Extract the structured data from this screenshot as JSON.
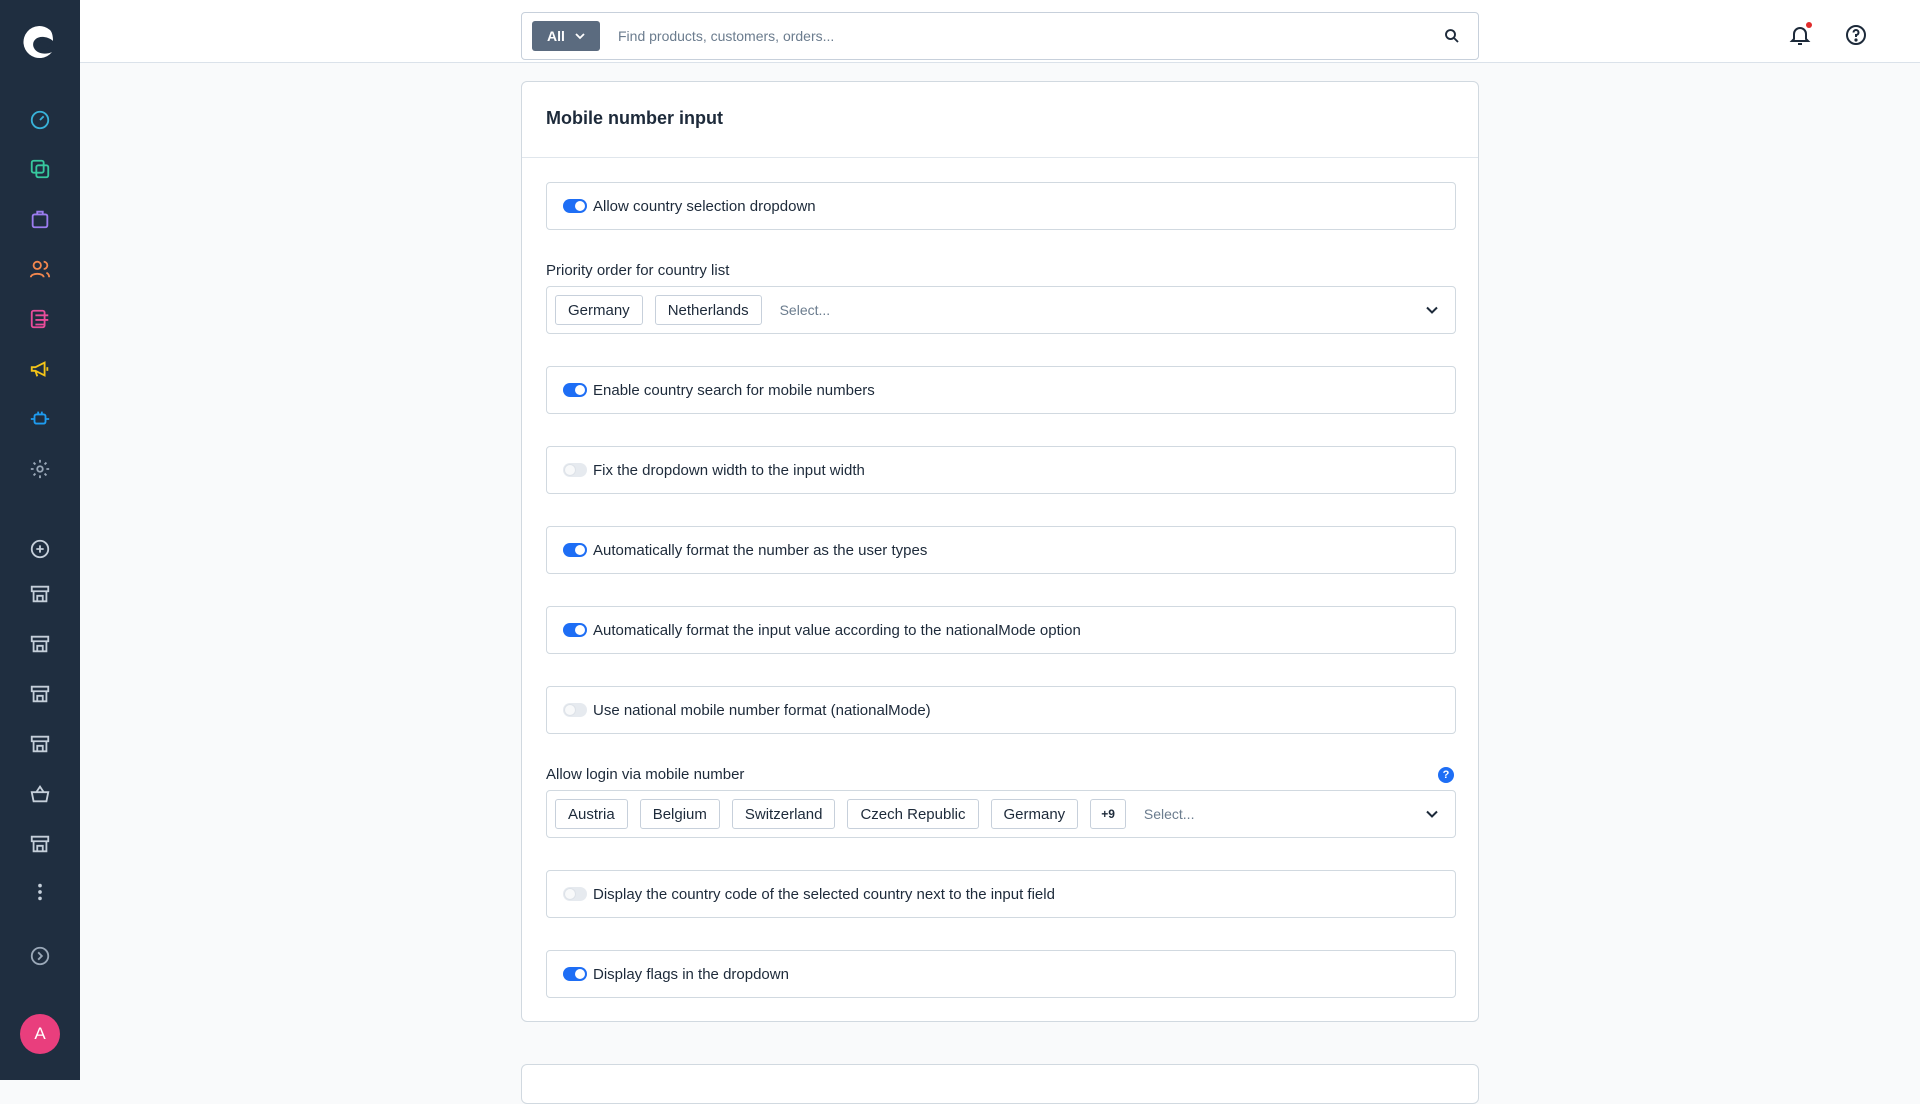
{
  "search": {
    "scope_label": "All",
    "placeholder": "Find products, customers, orders..."
  },
  "sidebar": {
    "avatar_initial": "A",
    "icons": [
      "dashboard-icon",
      "catalogue-icon",
      "orders-icon",
      "customers-icon",
      "content-icon",
      "marketing-icon",
      "extensions-icon",
      "settings-icon",
      "add-sales-channel-icon",
      "sales-channel-icon",
      "sales-channel-icon",
      "sales-channel-icon",
      "sales-channel-icon",
      "basket-icon",
      "sales-channel-icon",
      "more-icon",
      "expand-icon"
    ]
  },
  "card": {
    "title": "Mobile number input"
  },
  "settings": {
    "allow_country_dropdown": {
      "label": "Allow country selection dropdown",
      "enabled": true
    },
    "priority_order": {
      "label": "Priority order for country list",
      "selected": [
        "Germany",
        "Netherlands"
      ],
      "placeholder": "Select..."
    },
    "enable_country_search": {
      "label": "Enable country search for mobile numbers",
      "enabled": true
    },
    "fix_dropdown_width": {
      "label": "Fix the dropdown width to the input width",
      "enabled": false
    },
    "auto_format": {
      "label": "Automatically format the number as the user types",
      "enabled": true
    },
    "auto_format_national": {
      "label": "Automatically format the input value according to the nationalMode option",
      "enabled": true
    },
    "national_mode": {
      "label": "Use national mobile number format (nationalMode)",
      "enabled": false
    },
    "login_via_mobile": {
      "label": "Allow login via mobile number",
      "help": "?",
      "selected": [
        "Austria",
        "Belgium",
        "Switzerland",
        "Czech Republic",
        "Germany"
      ],
      "more": "+9",
      "placeholder": "Select..."
    },
    "display_country_code": {
      "label": "Display the country code of the selected country next to the input field",
      "enabled": false
    },
    "display_flags": {
      "label": "Display flags in the dropdown",
      "enabled": true
    }
  },
  "colors": {
    "sidebar_bg": "#1f2e40",
    "toggle_on": "#1e6ef5",
    "avatar": "#e93e7d",
    "notification_dot": "#e02b2b"
  }
}
